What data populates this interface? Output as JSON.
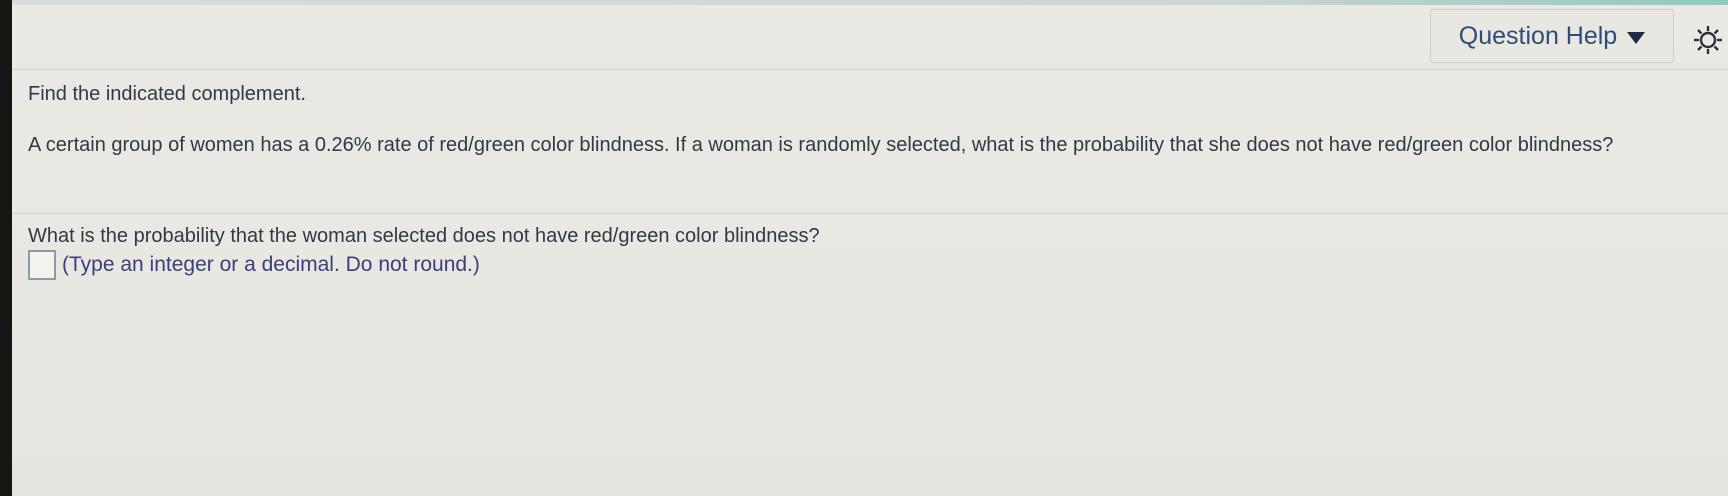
{
  "header": {
    "help_label": "Question Help",
    "help_icon": "caret-down-icon",
    "settings_icon": "gear-icon"
  },
  "question": {
    "instruction": "Find the indicated complement.",
    "body": "A certain group of women has a 0.26% rate of red/green color blindness. If a woman is randomly selected, what is the probability that she does not have red/green color blindness?",
    "prompt": "What is the probability that the woman selected does not have red/green color blindness?",
    "answer_value": "",
    "hint": "(Type an integer or a decimal. Do not round.)"
  },
  "colors": {
    "help_text": "#2f4d7a",
    "hint_text": "#39407a",
    "accent": "#8fc9bd"
  }
}
